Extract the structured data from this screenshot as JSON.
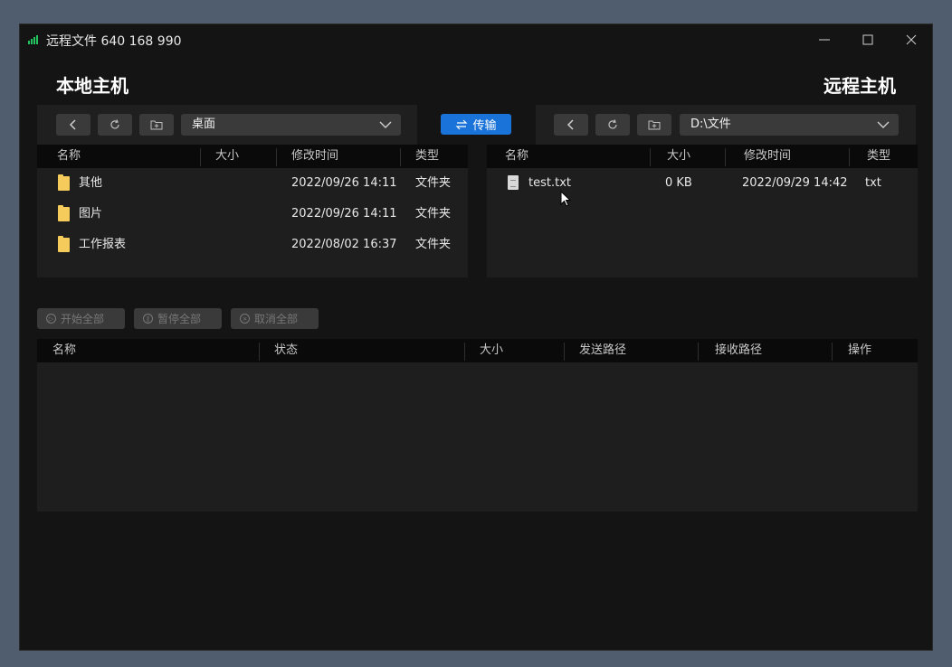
{
  "window": {
    "title": "远程文件 640 168 990",
    "signal_color": "#22c55e"
  },
  "hosts": {
    "local_title": "本地主机",
    "remote_title": "远程主机"
  },
  "local": {
    "path": "桌面",
    "columns": [
      "名称",
      "大小",
      "修改时间",
      "类型"
    ],
    "rows": [
      {
        "name": "其他",
        "size": "",
        "modified": "2022/09/26 14:11",
        "type": "文件夹"
      },
      {
        "name": "图片",
        "size": "",
        "modified": "2022/09/26 14:11",
        "type": "文件夹"
      },
      {
        "name": "工作报表",
        "size": "",
        "modified": "2022/08/02 16:37",
        "type": "文件夹"
      }
    ]
  },
  "remote": {
    "path": "D:\\文件",
    "columns": [
      "名称",
      "大小",
      "修改时间",
      "类型"
    ],
    "rows": [
      {
        "name": "test.txt",
        "size": "0 KB",
        "modified": "2022/09/29 14:42",
        "type": "txt"
      }
    ]
  },
  "transfer_button": {
    "label": "传输",
    "color": "#1a73d8"
  },
  "actions": {
    "start_all": "开始全部",
    "pause_all": "暂停全部",
    "cancel_all": "取消全部"
  },
  "queue": {
    "columns": [
      "名称",
      "状态",
      "大小",
      "发送路径",
      "接收路径",
      "操作"
    ]
  },
  "icons": {
    "back": "chevron-left-icon",
    "refresh": "refresh-icon",
    "new_folder": "new-folder-icon",
    "dropdown": "chevron-down-icon",
    "swap": "swap-icon",
    "folder": "folder-icon",
    "file": "file-icon"
  }
}
